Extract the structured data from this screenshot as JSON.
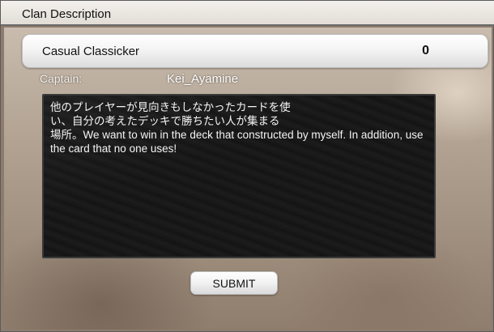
{
  "window": {
    "title": "Clan Description"
  },
  "clan": {
    "name": "Casual Classicker",
    "member_count": "0",
    "captain_label": "Captain:",
    "captain_name": "Kei_Ayamine",
    "description": "他のプレイヤーが見向きもしなかったカードを使\nい、自分の考えたデッキで勝ちたい人が集まる\n場所。We want to win in the deck that constructed by myself. In addition, use the card that no one uses!"
  },
  "actions": {
    "submit_label": "SUBMIT"
  }
}
